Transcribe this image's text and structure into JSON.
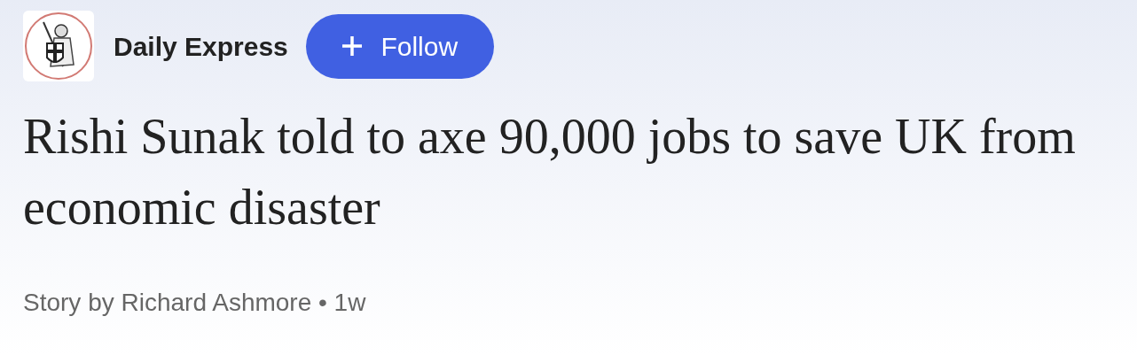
{
  "source": {
    "name": "Daily Express"
  },
  "follow_button": {
    "label": "Follow"
  },
  "headline": "Rishi Sunak told to axe 90,000 jobs to save UK from economic disaster",
  "byline": "Story by Richard Ashmore • 1w"
}
